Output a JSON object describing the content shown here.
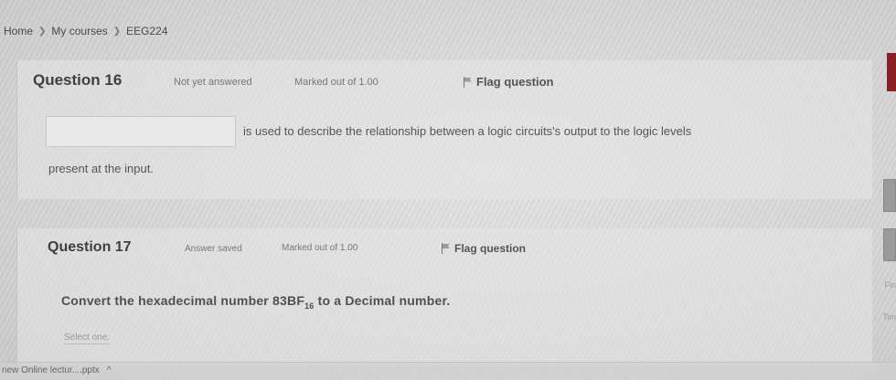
{
  "breadcrumb": {
    "home": "Home",
    "courses": "My courses",
    "course": "EEG224",
    "separator": ">"
  },
  "q16": {
    "number": "Question 16",
    "state": "Not yet answered",
    "mark": "Marked out of 1.00",
    "flag": "Flag question",
    "text_line1": "is used to describe the relationship between a logic circuits's output to the logic levels",
    "text_line2": "present at the input."
  },
  "q17": {
    "number": "Question 17",
    "state": "Answer saved",
    "mark": "Marked out of 1.00",
    "flag": "Flag question",
    "text_main": "Convert the hexadecimal number 83BF",
    "text_sub": "16",
    "text_end": " to a Decimal number.",
    "select_label": "Select one:"
  },
  "side": {
    "fin": "Fin",
    "tim": "Tim"
  },
  "download": {
    "filename": "new Online lectur....pptx",
    "chevron": "^"
  },
  "colors": {
    "accent_red": "#8b1f24"
  }
}
